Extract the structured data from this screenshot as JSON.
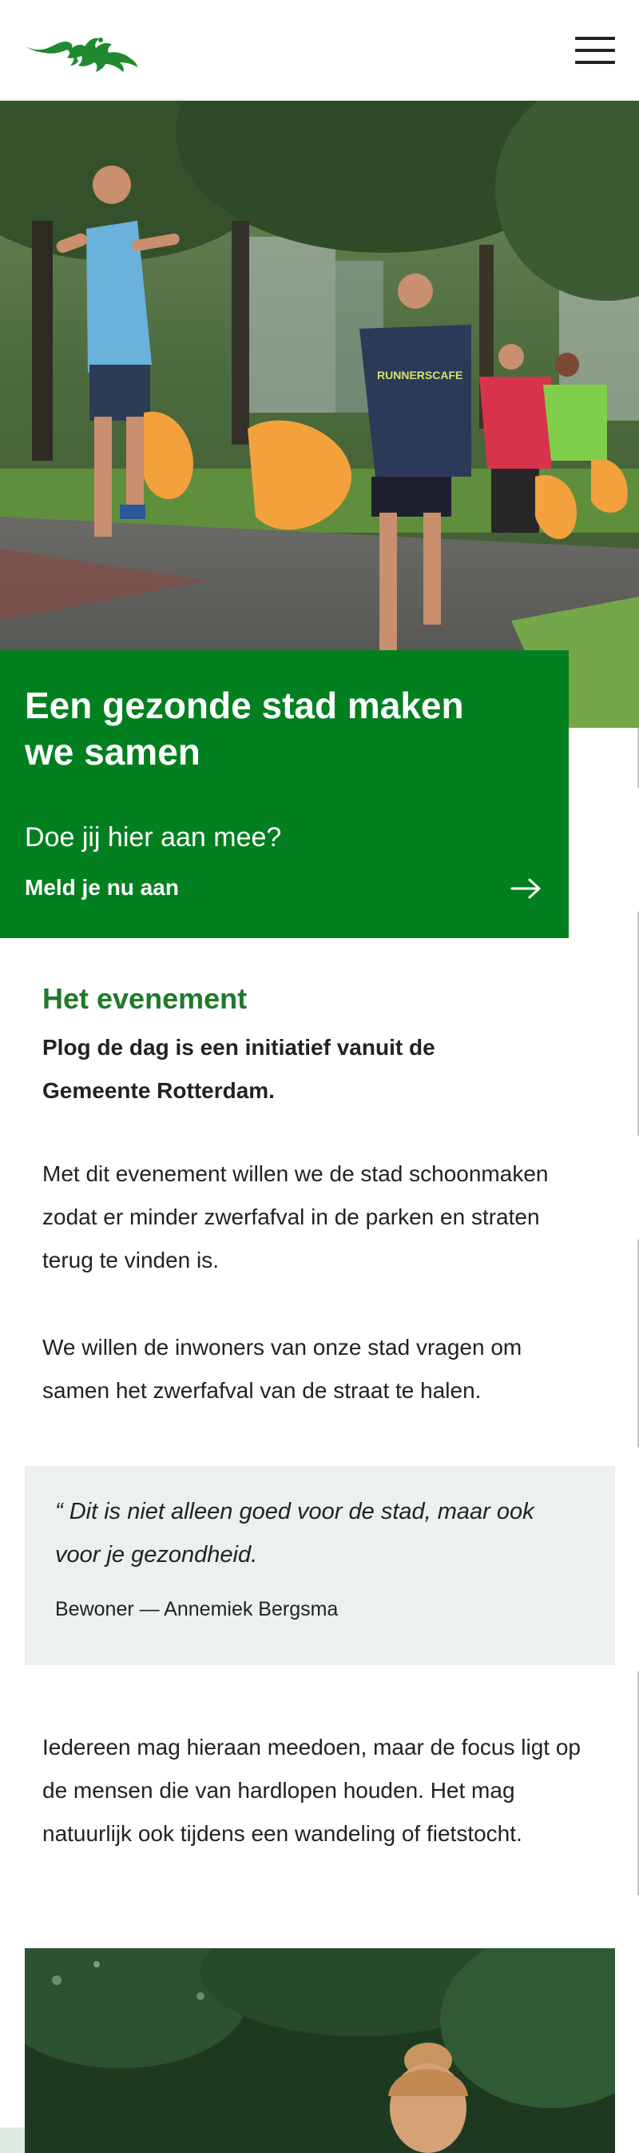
{
  "header": {
    "logo": "gemeente-rotterdam-logo",
    "menu_icon": "hamburger-menu-icon"
  },
  "hero": {
    "image": "runners-collecting-litter-photo",
    "shirt_text": "RUNNERSCAFE"
  },
  "callout": {
    "title": "Een gezonde stad maken we samen",
    "question": "Doe jij hier aan mee?",
    "cta_label": "Meld je nu aan",
    "cta_icon": "arrow-right-icon"
  },
  "event": {
    "heading": "Het evenement",
    "lead": "Plog de dag is een initiatief vanuit de Gemeente Rotterdam.",
    "paragraph_1": "Met dit evenement willen we de stad schoonmaken zodat er minder zwerfafval in de parken en straten terug te vinden is.",
    "paragraph_2": "We willen de inwoners van onze stad vragen om samen het zwerfafval van de straat te halen.",
    "quote": "“ Dit is niet alleen goed voor de stad, maar ook voor je gezondheid.",
    "quote_cite": "Bewoner — Annemiek Bergsma",
    "paragraph_3": "Iedereen mag hieraan meedoen, maar de focus ligt op de mensen die van hardlopen houden. Het mag natuurlijk ook tijdens een wandeling of fietstocht."
  },
  "bottom_photo": {
    "image": "woman-runner-photo"
  },
  "colors": {
    "brand_green": "#028020",
    "heading_green": "#1f7a2a",
    "quote_bg": "#ecf0f1",
    "text": "#222222"
  }
}
